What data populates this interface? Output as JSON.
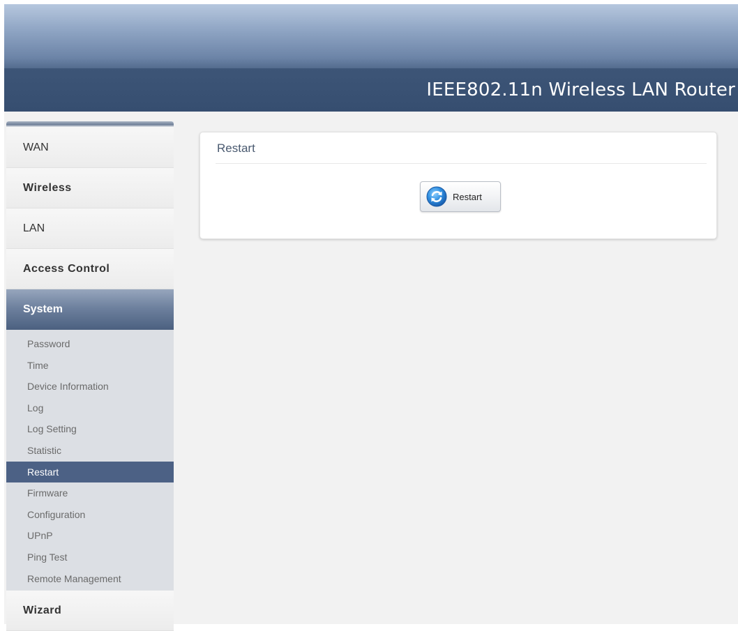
{
  "header": {
    "title": "IEEE802.11n  Wireless LAN Router"
  },
  "sidebar": {
    "items": [
      {
        "label": "WAN"
      },
      {
        "label": "Wireless"
      },
      {
        "label": "LAN"
      },
      {
        "label": "Access Control"
      },
      {
        "label": "System",
        "active": true
      },
      {
        "label": "Wizard"
      }
    ],
    "system_submenu": [
      {
        "label": "Password"
      },
      {
        "label": "Time"
      },
      {
        "label": "Device Information"
      },
      {
        "label": "Log"
      },
      {
        "label": "Log Setting"
      },
      {
        "label": "Statistic"
      },
      {
        "label": "Restart",
        "active": true
      },
      {
        "label": "Firmware"
      },
      {
        "label": "Configuration"
      },
      {
        "label": "UPnP"
      },
      {
        "label": "Ping Test"
      },
      {
        "label": "Remote Management"
      }
    ]
  },
  "main": {
    "panel_title": "Restart",
    "restart_button_label": "Restart",
    "restart_icon": "restart-icon"
  },
  "colors": {
    "header_band": "#3d5577",
    "active_menu": "#4c6185",
    "page_background": "#f2f2f2"
  }
}
